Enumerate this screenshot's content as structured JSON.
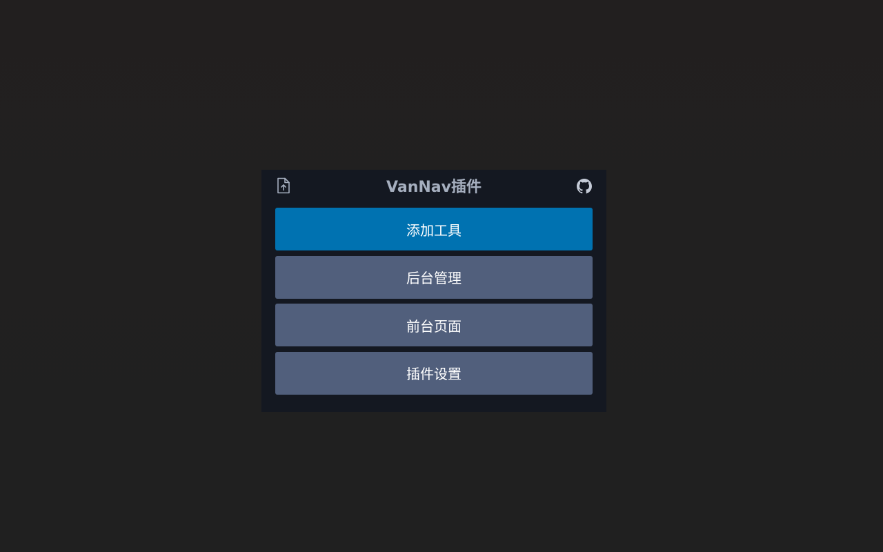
{
  "popup": {
    "title": "VanNav插件",
    "icons": {
      "left": "file-upload-icon",
      "right": "github-icon"
    },
    "buttons": [
      {
        "label": "添加工具",
        "style": "primary"
      },
      {
        "label": "后台管理",
        "style": "secondary"
      },
      {
        "label": "前台页面",
        "style": "secondary"
      },
      {
        "label": "插件设置",
        "style": "secondary"
      }
    ]
  },
  "colors": {
    "page_bg": "#212020",
    "popup_bg": "#141821",
    "title": "#a6afbf",
    "primary_button": "#0072b1",
    "secondary_button": "#515f7c",
    "button_text": "#ffffff"
  }
}
